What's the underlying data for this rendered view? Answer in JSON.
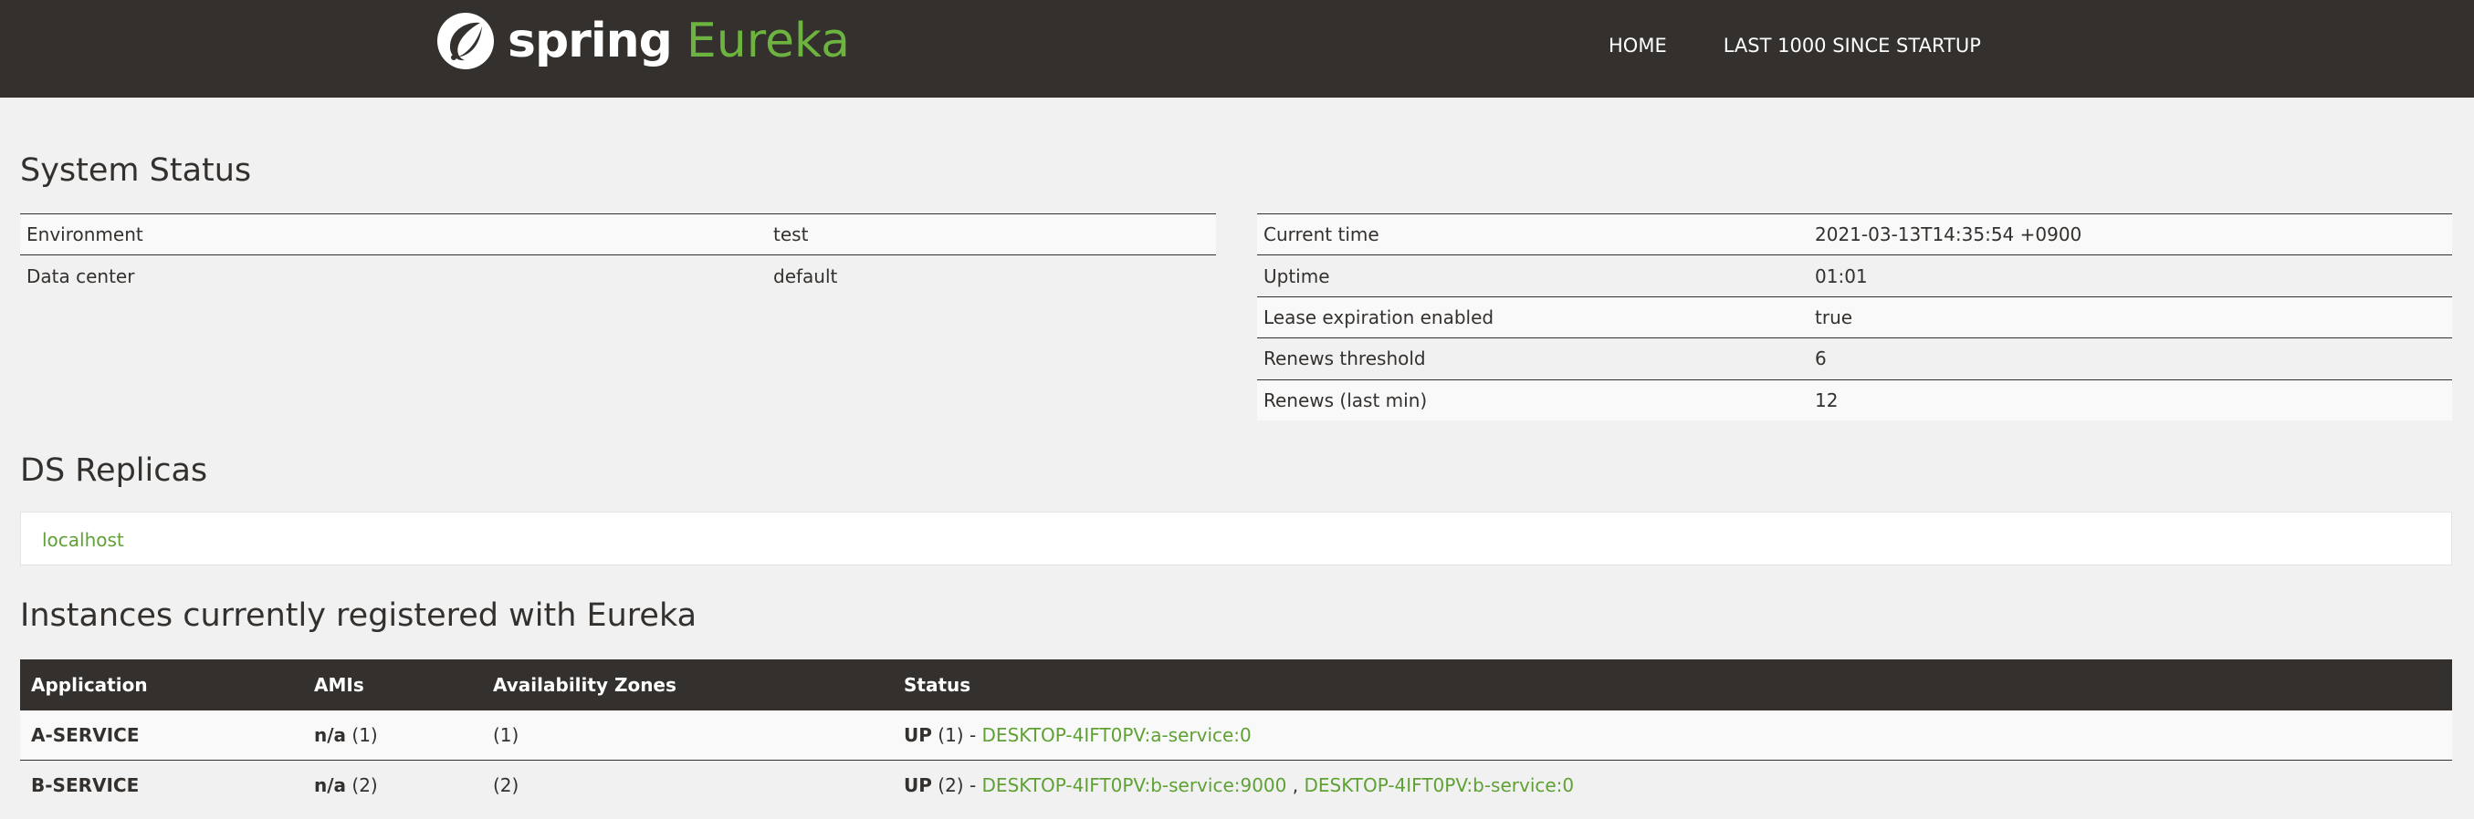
{
  "nav": {
    "brand_spring": "spring",
    "brand_eureka": "Eureka",
    "links": [
      "HOME",
      "LAST 1000 SINCE STARTUP"
    ]
  },
  "system_status": {
    "title": "System Status",
    "left": [
      {
        "label": "Environment",
        "value": "test"
      },
      {
        "label": "Data center",
        "value": "default"
      }
    ],
    "right": [
      {
        "label": "Current time",
        "value": "2021-03-13T14:35:54 +0900"
      },
      {
        "label": "Uptime",
        "value": "01:01"
      },
      {
        "label": "Lease expiration enabled",
        "value": "true"
      },
      {
        "label": "Renews threshold",
        "value": "6"
      },
      {
        "label": "Renews (last min)",
        "value": "12"
      }
    ]
  },
  "ds_replicas": {
    "title": "DS Replicas",
    "items": [
      "localhost"
    ]
  },
  "instances": {
    "title": "Instances currently registered with Eureka",
    "headers": [
      "Application",
      "AMIs",
      "Availability Zones",
      "Status"
    ],
    "rows": [
      {
        "application": "A-SERVICE",
        "ami_bold": "n/a",
        "ami_count": "(1)",
        "zones": "(1)",
        "status_bold": "UP",
        "status_count": "(1) - ",
        "instances": [
          "DESKTOP-4IFT0PV:a-service:0"
        ]
      },
      {
        "application": "B-SERVICE",
        "ami_bold": "n/a",
        "ami_count": "(2)",
        "zones": "(2)",
        "status_bold": "UP",
        "status_count": "(2) - ",
        "instances": [
          "DESKTOP-4IFT0PV:b-service:9000",
          "DESKTOP-4IFT0PV:b-service:0"
        ],
        "separator": " , "
      }
    ]
  },
  "colors": {
    "navbar_bg": "#34302d",
    "brand_green": "#6db33f",
    "link_green": "#5fa134",
    "page_bg": "#f1f1f1"
  }
}
